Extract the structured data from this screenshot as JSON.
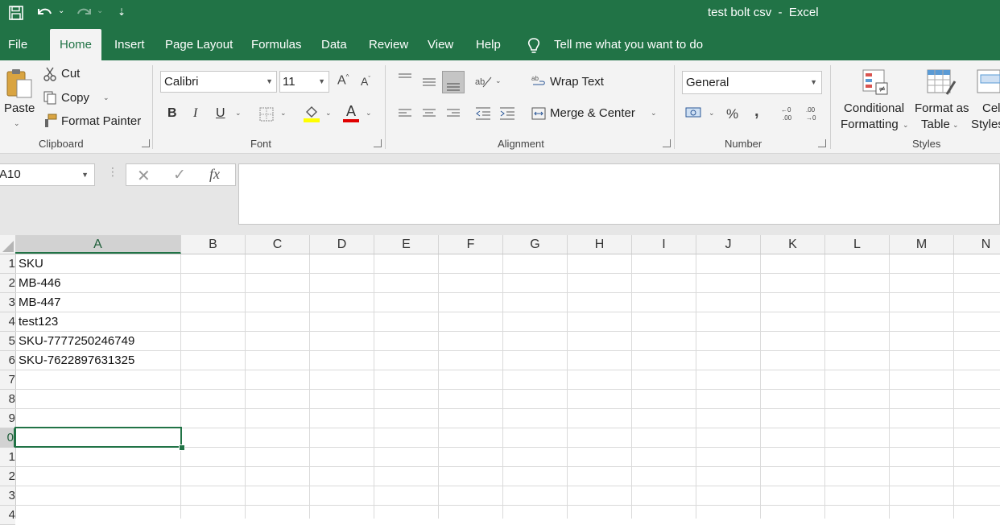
{
  "window": {
    "title": "test bolt csv  -  Excel"
  },
  "tabs": [
    {
      "label": "File"
    },
    {
      "label": "Home"
    },
    {
      "label": "Insert"
    },
    {
      "label": "Page Layout"
    },
    {
      "label": "Formulas"
    },
    {
      "label": "Data"
    },
    {
      "label": "Review"
    },
    {
      "label": "View"
    },
    {
      "label": "Help"
    }
  ],
  "tell_me": "Tell me what you want to do",
  "clipboard": {
    "paste": "Paste",
    "cut": "Cut",
    "copy": "Copy",
    "format_painter": "Format Painter",
    "label": "Clipboard"
  },
  "font": {
    "name": "Calibri",
    "size": "11",
    "bold": "B",
    "italic": "I",
    "underline": "U",
    "font_color_letter": "A",
    "label": "Font",
    "highlight_color": "#ffff00",
    "font_color": "#e00000"
  },
  "alignment": {
    "wrap_text": "Wrap Text",
    "merge_center": "Merge & Center",
    "label": "Alignment"
  },
  "number": {
    "format": "General",
    "percent": "%",
    "comma": ",",
    "label": "Number"
  },
  "styles": {
    "conditional_1": "Conditional",
    "conditional_2": "Formatting",
    "format_as_1": "Format as",
    "format_as_2": "Table",
    "cell_1": "Cel",
    "cell_2": "Styles",
    "label": "Styles"
  },
  "formula_bar": {
    "name_box": "A10",
    "fx": "fx",
    "content": ""
  },
  "columns": [
    "A",
    "B",
    "C",
    "D",
    "E",
    "F",
    "G",
    "H",
    "I",
    "J",
    "K",
    "L",
    "M",
    "N"
  ],
  "rows": [
    "1",
    "2",
    "3",
    "4",
    "5",
    "6",
    "7",
    "8",
    "9",
    "0",
    "1",
    "2",
    "3",
    "4"
  ],
  "cells_col_a": [
    "SKU",
    "MB-446",
    "MB-447",
    "test123",
    "SKU-7777250246749",
    "SKU-7622897631325",
    "",
    "",
    "",
    "",
    "",
    "",
    "",
    ""
  ],
  "selected_cell": "A10",
  "colors": {
    "excel_green": "#217346",
    "ribbon_bg": "#f3f3f3",
    "grid": "#dadada"
  }
}
